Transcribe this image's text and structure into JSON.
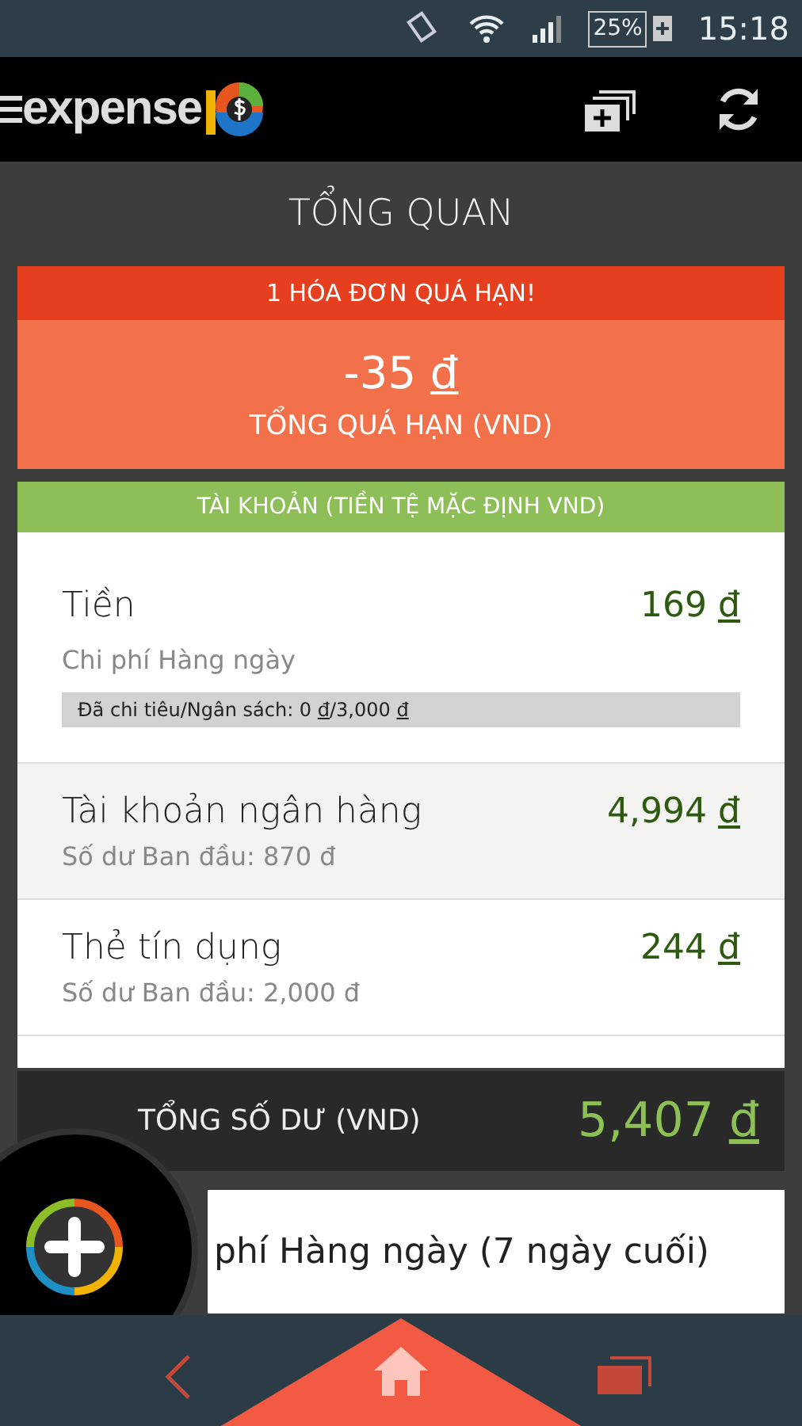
{
  "status_bar": {
    "battery": "25%",
    "time": "15:18"
  },
  "app_bar": {
    "logo_text": "expense"
  },
  "page_title": "TỔNG QUAN",
  "overdue": {
    "header": "1 HÓA ĐƠN QUÁ HẠN!",
    "amount": "-35",
    "currency": "đ",
    "label": "TỔNG QUÁ HẠN (VND)"
  },
  "accounts": {
    "header": "TÀI KHOẢN (TIỀN TỆ MẶC ĐỊNH VND)",
    "items": [
      {
        "kind": "budget",
        "name": "Tiền",
        "amount": "169",
        "currency": "đ",
        "subtitle": "Chi phí Hàng ngày",
        "budget_text": "Đã chi tiêu/Ngân sách: 0 **đ**/3,000 **đ**",
        "selected": false
      },
      {
        "kind": "plain",
        "name": "Tài khoản ngân hàng",
        "amount": "4,994",
        "currency": "đ",
        "subtitle": "Số dư Ban đầu: 870 đ",
        "selected": true
      },
      {
        "kind": "plain",
        "name": "Thẻ tín dụng",
        "amount": "244",
        "currency": "đ",
        "subtitle": "Số dư Ban đầu: 2,000 đ",
        "selected": false
      }
    ]
  },
  "total": {
    "label": "TỔNG SỐ DƯ (VND)",
    "amount": "5,407",
    "currency": "đ"
  },
  "expense_card": {
    "title": "phí Hàng ngày (7 ngày cuối)"
  }
}
